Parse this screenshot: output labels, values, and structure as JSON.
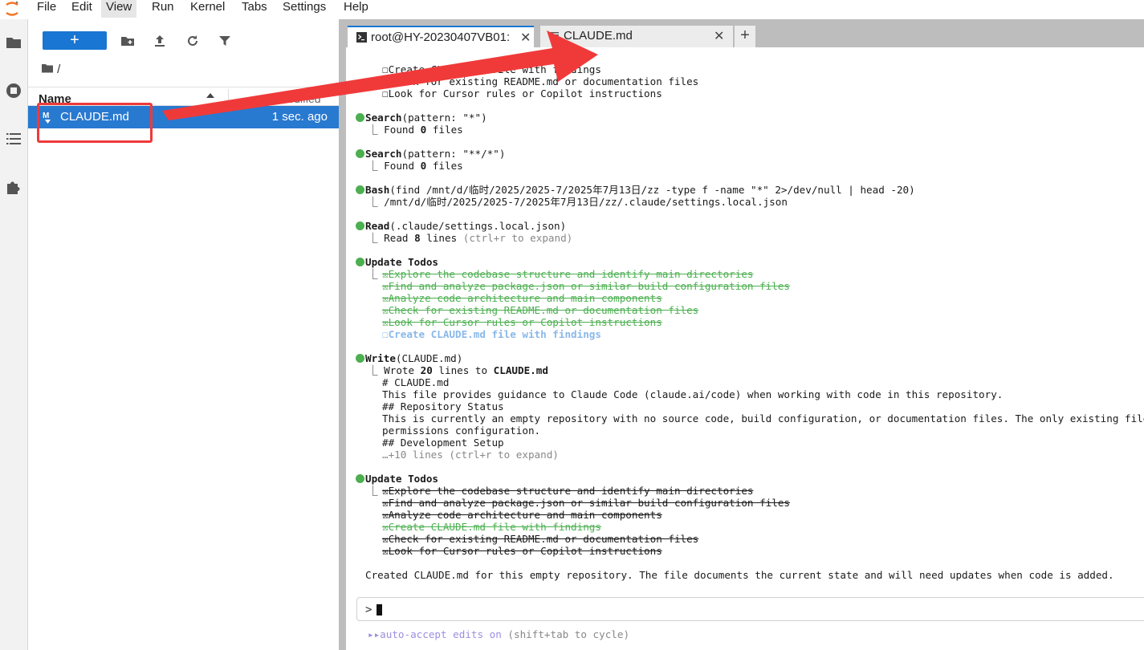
{
  "menubar": {
    "items": [
      "File",
      "Edit",
      "View",
      "Run",
      "Kernel",
      "Tabs",
      "Settings",
      "Help"
    ],
    "active": "View"
  },
  "rail": {
    "icons": [
      "folder-icon",
      "running-stop-icon",
      "toc-list-icon",
      "extension-puzzle-icon"
    ]
  },
  "filebrowser": {
    "new_label": "+",
    "breadcrumb": "/",
    "columns": {
      "name": "Name",
      "modified": "...modified"
    },
    "files": [
      {
        "name": "CLAUDE.md",
        "modified": "1 sec. ago",
        "icon": "markdown-icon"
      }
    ]
  },
  "tabs": [
    {
      "label": "root@HY-20230407VB01: ",
      "icon": "terminal-icon",
      "active": true
    },
    {
      "label": "CLAUDE.md",
      "icon": "file-text-icon",
      "active": false
    }
  ],
  "terminal": {
    "top_fragment": [
      "☐Create CLAUDE.md file with findings",
      "☐Check for existing README.md or documentation files",
      "☐Look for Cursor rules or Copilot instructions"
    ],
    "search1": {
      "tool": "Search",
      "args": "(pattern: \"*\")",
      "result_prefix": "⎿ Found ",
      "count": "0",
      "result_suffix": " files"
    },
    "search2": {
      "tool": "Search",
      "args": "(pattern: \"**/*\")",
      "result_prefix": "⎿ Found ",
      "count": "0",
      "result_suffix": " files"
    },
    "bash": {
      "tool": "Bash",
      "args": "(find /mnt/d/临时/2025/2025-7/2025年7月13日/zz -type f -name \"*\" 2>/dev/null | head -20)",
      "result": "⎿ /mnt/d/临时/2025/2025-7/2025年7月13日/zz/.claude/settings.local.json"
    },
    "read": {
      "tool": "Read",
      "args": "(.claude/settings.local.json)",
      "result_prefix": "⎿ Read ",
      "count": "8",
      "result_suffix": " lines ",
      "hint": "(ctrl+r to expand)"
    },
    "todos1": {
      "tool": "Update Todos",
      "items": [
        "☒Explore the codebase structure and identify main directories",
        "☒Find and analyze package.json or similar build configuration files",
        "☒Analyze code architecture and main components",
        "☒Check for existing README.md or documentation files",
        "☒Look for Cursor rules or Copilot instructions",
        "☐Create CLAUDE.md file with findings"
      ]
    },
    "write": {
      "tool": "Write",
      "args": "(CLAUDE.md)",
      "result_prefix": "⎿ Wrote ",
      "count": "20",
      "result_mid": " lines to ",
      "file": "CLAUDE.md",
      "lines": [
        "# CLAUDE.md",
        "This file provides guidance to Claude Code (claude.ai/code) when working with code in this repository.",
        "## Repository Status",
        "This is currently an empty repository with no source code, build configuration, or documentation files. The only existing file is `.claude/settings.local.json` which contains",
        "permissions configuration.",
        "## Development Setup",
        "…+10 lines (ctrl+r to expand)"
      ]
    },
    "todos2": {
      "tool": "Update Todos",
      "items": [
        "☒Explore the codebase structure and identify main directories",
        "☒Find and analyze package.json or similar build configuration files",
        "☒Analyze code architecture and main components",
        "☒Create CLAUDE.md file with findings",
        "☒Check for existing README.md or documentation files",
        "☒Look for Cursor rules or Copilot instructions"
      ]
    },
    "summary": "Created CLAUDE.md for this empty repository. The file documents the current state and will need updates when code is added.",
    "prompt": ">",
    "footer_arrows": "▸▸",
    "footer": "auto-accept edits on ",
    "footer_hint": "(shift+tab to cycle)"
  },
  "colors": {
    "accent": "#1976d2",
    "selection": "#2879d0",
    "annotation_red": "#f03a3a",
    "done_green": "#4caf50",
    "pending_blue": "#8ab8ea"
  }
}
